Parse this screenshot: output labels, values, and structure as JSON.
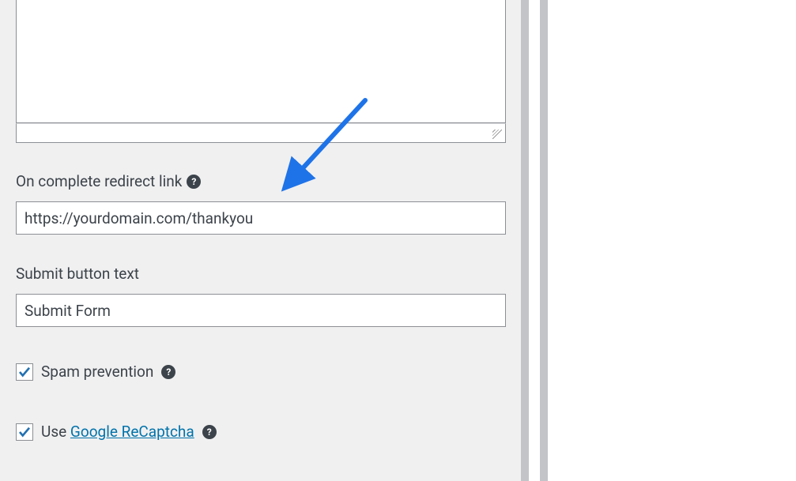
{
  "fields": {
    "redirect": {
      "label": "On complete redirect link",
      "value": "https://yourdomain.com/thankyou"
    },
    "button_text": {
      "label": "Submit button text",
      "value": "Submit Form"
    },
    "spam_prevention": {
      "label": "Spam prevention",
      "checked": true
    },
    "recaptcha": {
      "label_prefix": "Use ",
      "link_text": "Google ReCaptcha",
      "checked": true
    }
  }
}
